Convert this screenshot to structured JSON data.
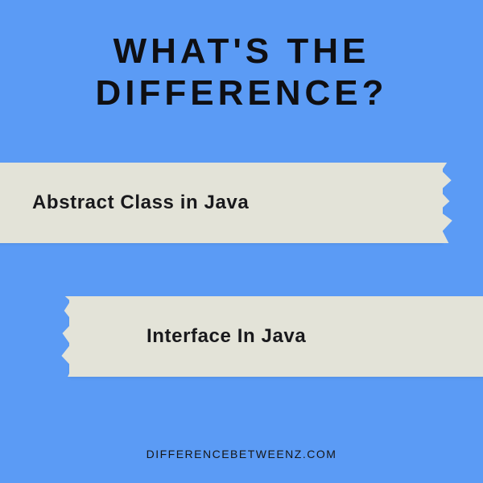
{
  "heading_line1": "WHAT'S THE",
  "heading_line2": "DIFFERENCE?",
  "tape1_label": "Abstract Class in Java",
  "tape2_label": "Interface In Java",
  "footer_text": "DIFFERENCEBETWEENZ.COM",
  "colors": {
    "background": "#5b9bf5",
    "tape": "#e3e3d8",
    "text_dark": "#0f0f12"
  }
}
